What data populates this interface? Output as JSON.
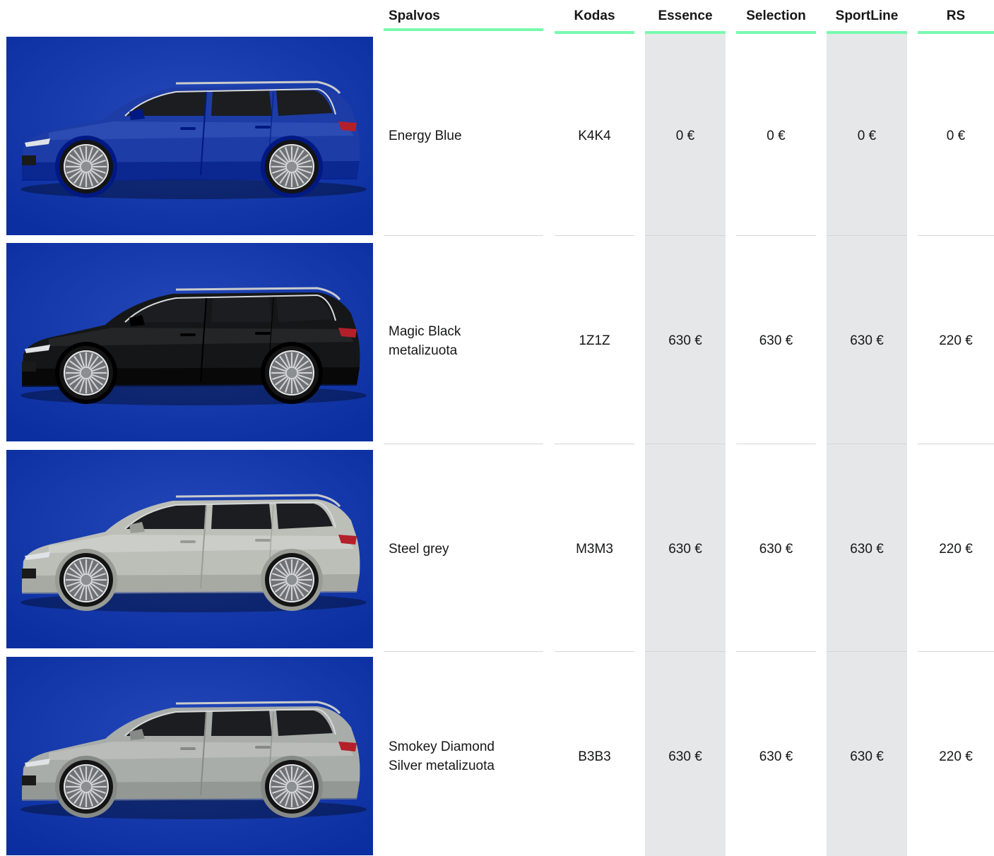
{
  "headers": {
    "color": "Spalvos",
    "code": "Kodas",
    "trims": [
      "Essence",
      "Selection",
      "SportLine",
      "RS"
    ]
  },
  "rows": [
    {
      "name": "Energy Blue",
      "code": "K4K4",
      "prices": [
        "0 €",
        "0 €",
        "0 €",
        "0 €"
      ],
      "image": {
        "subject": "car-side-view",
        "body_color": "#1d3ca5",
        "background": "#0b2fa0"
      }
    },
    {
      "name": "Magic Black metalizuota",
      "code": "1Z1Z",
      "prices": [
        "630 €",
        "630 €",
        "630 €",
        "220 €"
      ],
      "image": {
        "subject": "car-side-view",
        "body_color": "#151617",
        "background": "#39393b"
      }
    },
    {
      "name": "Steel grey",
      "code": "M3M3",
      "prices": [
        "630 €",
        "630 €",
        "630 €",
        "220 €"
      ],
      "image": {
        "subject": "car-side-view",
        "body_color": "#bcbeb8",
        "background": "#9a9c98"
      }
    },
    {
      "name": "Smokey Diamond Silver metalizuota",
      "code": "B3B3",
      "prices": [
        "630 €",
        "630 €",
        "630 €",
        "220 €"
      ],
      "image": {
        "subject": "car-side-view",
        "body_color": "#a9adaa",
        "background": "#999b99"
      }
    }
  ],
  "colors": {
    "header_underline": "#78faae",
    "highlight_column": "#e6e7e8",
    "row_separator": "#d4d5d6",
    "text": "#161718"
  }
}
